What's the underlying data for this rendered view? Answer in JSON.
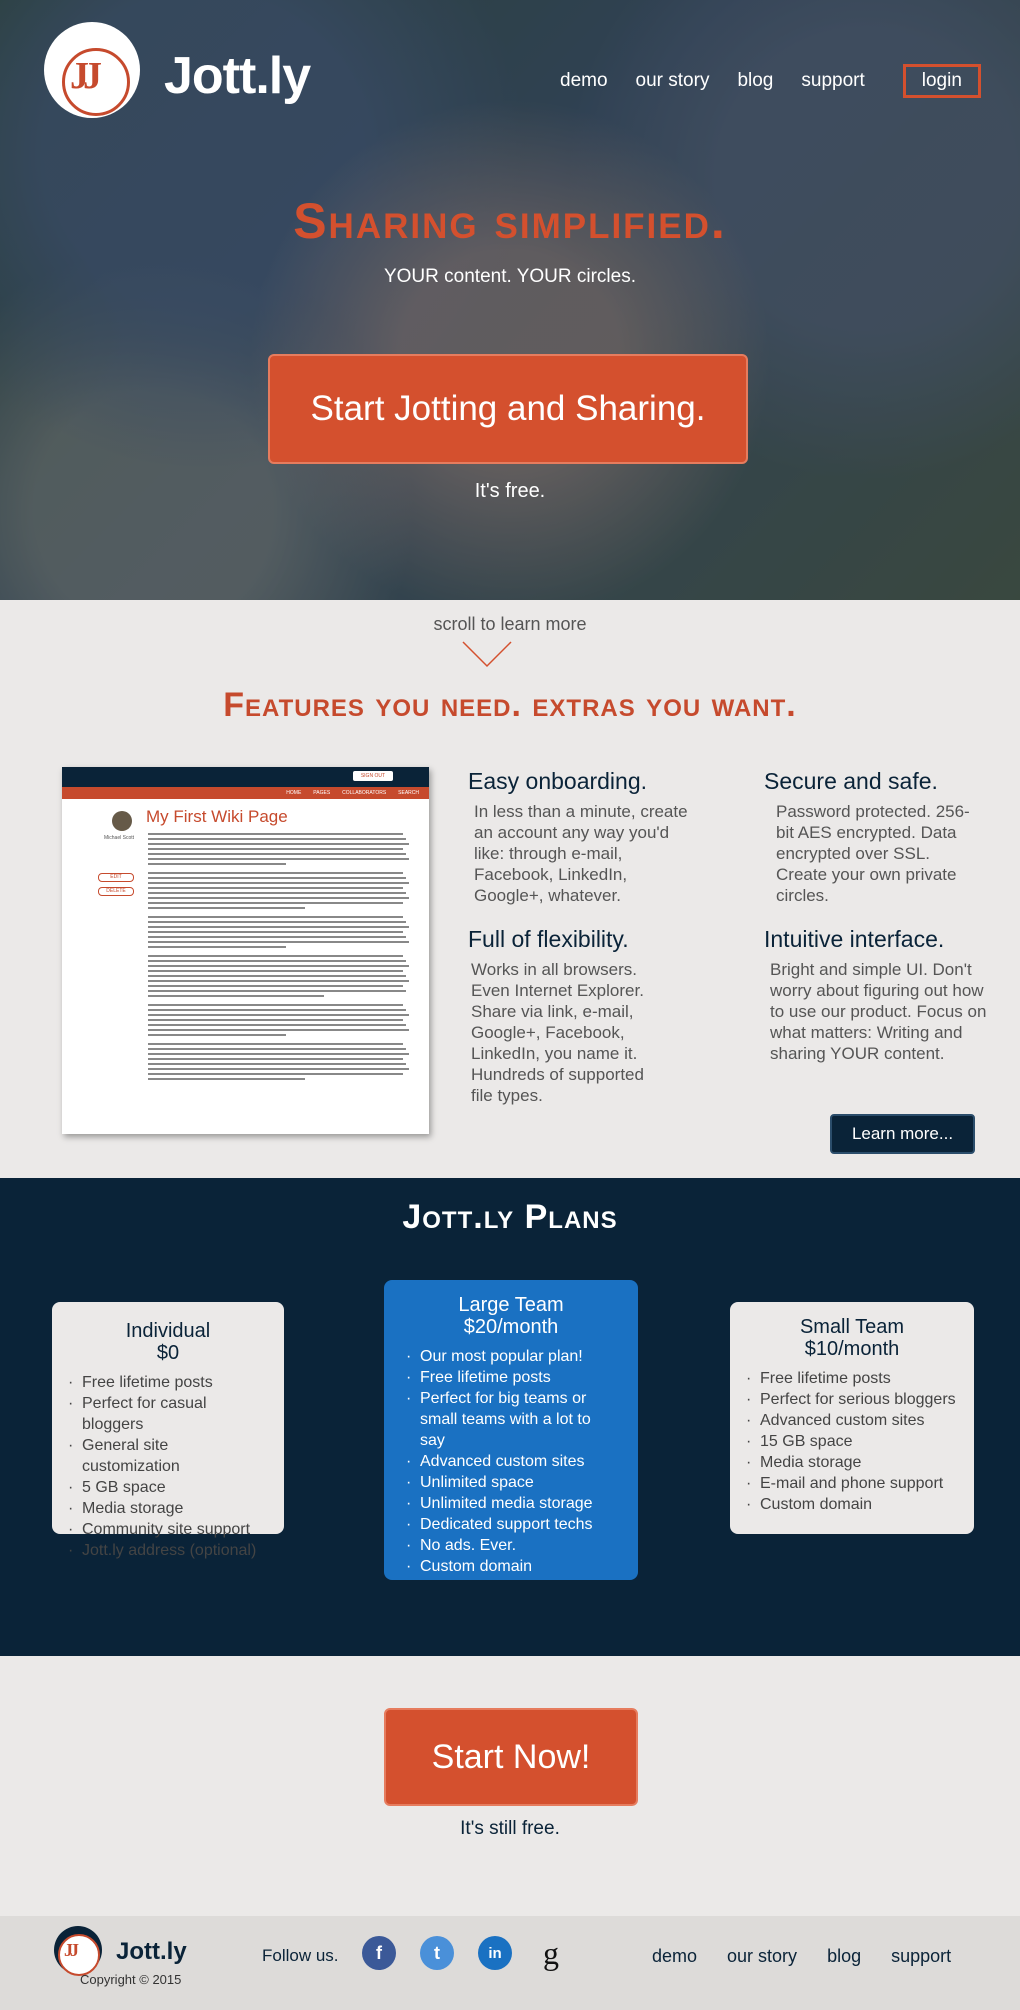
{
  "header": {
    "logo_text": "Jott.ly",
    "logo_mark": "JJ",
    "nav": [
      "demo",
      "our story",
      "blog",
      "support"
    ],
    "login": "login"
  },
  "hero": {
    "title": "Sharing simplified.",
    "subtitle": "YOUR content. YOUR circles.",
    "cta": "Start Jotting and Sharing.",
    "free_note": "It's free."
  },
  "features": {
    "scroll_hint": "scroll to learn more",
    "title": "Features you need. extras you want.",
    "items": [
      {
        "title": "Easy onboarding.",
        "text": "In less than a minute, create an account any way you'd like: through e-mail, Facebook, LinkedIn, Google+, whatever."
      },
      {
        "title": "Secure and safe.",
        "text": "Password protected. 256-bit AES encrypted. Data encrypted over SSL. Create your own private circles."
      },
      {
        "title": "Full of flexibility.",
        "text": "Works in all browsers. Even Internet Explorer. Share via link, e-mail, Google+, Facebook, LinkedIn, you name it. Hundreds of supported file types."
      },
      {
        "title": "Intuitive interface.",
        "text": "Bright and simple UI. Don't worry about figuring out how to use our product. Focus on what matters: Writing and sharing YOUR content."
      }
    ],
    "learn_more": "Learn more..."
  },
  "wiki_preview": {
    "signout": "SIGN OUT",
    "nav": [
      "HOME",
      "PAGES",
      "COLLABORATORS",
      "SEARCH"
    ],
    "page_title": "My First Wiki Page",
    "user_name": "Michael Scott",
    "edit": "EDIT",
    "delete": "DELETE"
  },
  "plans": {
    "title": "Jott.ly Plans",
    "individual": {
      "name": "Individual",
      "price": "$0",
      "features": [
        "Free lifetime posts",
        "Perfect for casual bloggers",
        "General site customization",
        "5 GB space",
        "Media storage",
        "Community site support",
        "Jott.ly address (optional)"
      ]
    },
    "large_team": {
      "name": "Large Team",
      "price": "$20/month",
      "features": [
        "Our most popular plan!",
        "Free lifetime posts",
        "Perfect for big teams or small teams with a lot to say",
        "Advanced custom sites",
        "Unlimited space",
        "Unlimited media storage",
        "Dedicated support techs",
        "No ads. Ever.",
        "Custom domain"
      ]
    },
    "small_team": {
      "name": "Small Team",
      "price": "$10/month",
      "features": [
        "Free lifetime posts",
        "Perfect for serious bloggers",
        "Advanced custom sites",
        "15 GB space",
        "Media storage",
        "E-mail and phone support",
        "Custom domain"
      ]
    }
  },
  "cta_bottom": {
    "button": "Start Now!",
    "note": "It's still free."
  },
  "footer": {
    "logo_text": "Jott.ly",
    "logo_mark": "JJ",
    "copyright": "Copyright © 2015",
    "follow": "Follow us.",
    "social": [
      {
        "icon": "facebook-icon",
        "glyph": "f",
        "color": "#3b5998"
      },
      {
        "icon": "twitter-icon",
        "glyph": "t",
        "color": "#4a90d9"
      },
      {
        "icon": "linkedin-icon",
        "glyph": "in",
        "color": "#1a71c2"
      },
      {
        "icon": "google-icon",
        "glyph": "g",
        "color": "#111111"
      }
    ],
    "nav": [
      "demo",
      "our story",
      "blog",
      "support"
    ]
  },
  "colors": {
    "accent": "#d4502e",
    "navy": "#0a2338",
    "blue": "#1a71c2",
    "background": "#ebe9e8"
  }
}
